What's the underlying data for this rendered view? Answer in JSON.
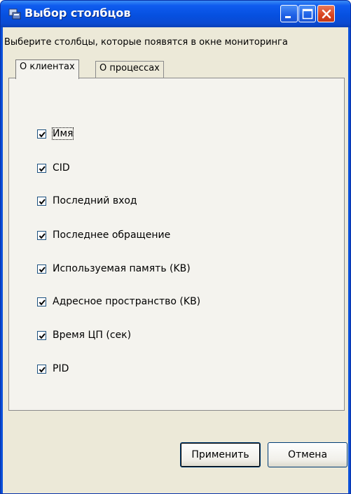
{
  "window": {
    "title": "Выбор столбцов"
  },
  "hint": "Выберите столбцы, которые появятся в окне мониторинга",
  "tabs": [
    {
      "label": "О клиентах",
      "active": true
    },
    {
      "label": "О процессах",
      "active": false
    }
  ],
  "columns": [
    {
      "label": "Имя",
      "checked": true
    },
    {
      "label": "CID",
      "checked": true
    },
    {
      "label": "Последний вход",
      "checked": true
    },
    {
      "label": "Последнее обращение",
      "checked": true
    },
    {
      "label": "Используемая память (KB)",
      "checked": true
    },
    {
      "label": "Адресное пространство (KB)",
      "checked": true
    },
    {
      "label": "Время ЦП (сек)",
      "checked": true
    },
    {
      "label": "PID",
      "checked": true
    }
  ],
  "buttons": {
    "apply": "Применить",
    "cancel": "Отмена"
  },
  "icons": {
    "title": "app-icon",
    "minimize": "minimize-icon",
    "maximize": "maximize-icon",
    "close": "close-icon",
    "check": "checkmark-icon"
  },
  "colors": {
    "titlebar": "#0650e0",
    "client": "#ece9d8",
    "close_button": "#d9431e"
  }
}
